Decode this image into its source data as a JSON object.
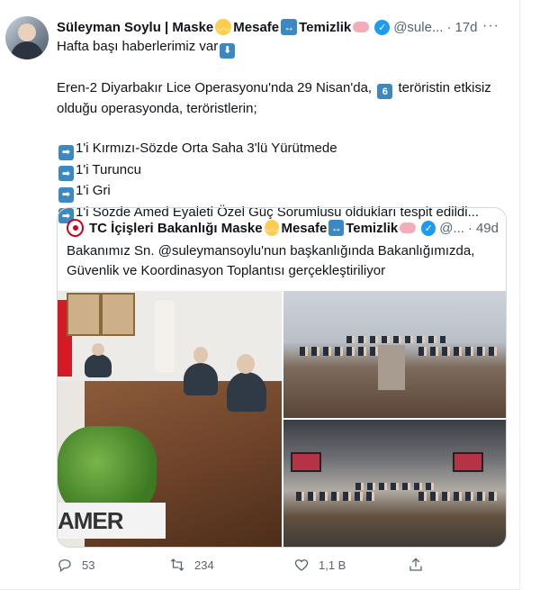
{
  "tweet": {
    "author_name": "Süleyman Soylu | Maske",
    "name_part_2": "Mesafe",
    "name_part_3": "Temizlik",
    "handle": "@sule...",
    "separator": "·",
    "time": "17d",
    "more": "···",
    "lines": [
      "Hafta başı haberlerimiz var",
      "",
      "Eren-2 Diyarbakır Lice Operasyonu'nda 29 Nisan'da,",
      "teröristin etkisiz",
      "olduğu operasyonda, teröristlerin;",
      "",
      "1'i Kırmızı-Sözde Orta Saha 3'lü Yürütmede",
      "1'i Turuncu",
      "1'i Gri",
      "1'i Sözde Amed Eyaleti Özel Güç Sorumlusu oldukları tespit edildi..."
    ],
    "number_badge": "6"
  },
  "quote": {
    "author_name": "TC İçişleri Bakanlığı Maske",
    "name_part_2": "Mesafe",
    "name_part_3": "Temizlik",
    "handle": "@...",
    "separator": "·",
    "time": "49d",
    "text_line_1": "Bakanımız Sn. @suleymansoylu'nun başkanlığında Bakanlığımızda,",
    "text_line_2": "Güvenlik ve Koordinasyon Toplantısı gerçekleştiriliyor",
    "photo_sign": "AMER"
  },
  "actions": {
    "replies": "53",
    "retweets": "234",
    "likes": "1,1 B"
  },
  "icons": {
    "reply": "reply-icon",
    "retweet": "retweet-icon",
    "like": "heart-icon",
    "share": "share-icon",
    "verified": "verified-badge-icon"
  },
  "colors": {
    "verified": "#1d9bf0",
    "emoji_blue": "#3b88c3",
    "muted": "#536471"
  }
}
